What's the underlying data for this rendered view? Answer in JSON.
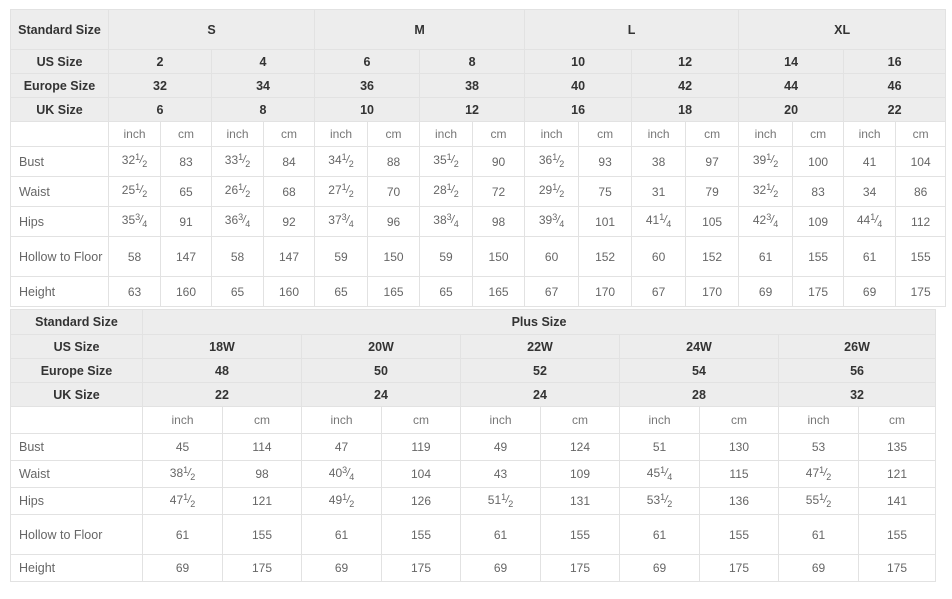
{
  "standard_table": {
    "label_column_header": "Standard Size",
    "row_labels": {
      "us": "US Size",
      "europe": "Europe Size",
      "uk": "UK Size",
      "bust": "Bust",
      "waist": "Waist",
      "hips": "Hips",
      "hollow": "Hollow to Floor",
      "height": "Height"
    },
    "unit_inch": "inch",
    "unit_cm": "cm",
    "groups": [
      {
        "name": "S",
        "span": 2
      },
      {
        "name": "M",
        "span": 2
      },
      {
        "name": "L",
        "span": 2
      },
      {
        "name": "XL",
        "span": 2
      }
    ],
    "us_sizes": [
      "2",
      "4",
      "6",
      "8",
      "10",
      "12",
      "14",
      "16"
    ],
    "europe_sizes": [
      "32",
      "34",
      "36",
      "38",
      "40",
      "42",
      "44",
      "46"
    ],
    "uk_sizes": [
      "6",
      "8",
      "10",
      "12",
      "16",
      "18",
      "20",
      "22"
    ],
    "measurements": [
      {
        "label": "Bust",
        "inch": [
          "32 1/2",
          "33 1/2",
          "34 1/2",
          "35 1/2",
          "36 1/2",
          "38",
          "39 1/2",
          "41"
        ],
        "cm": [
          "83",
          "84",
          "88",
          "90",
          "93",
          "97",
          "100",
          "104"
        ]
      },
      {
        "label": "Waist",
        "inch": [
          "25 1/2",
          "26 1/2",
          "27 1/2",
          "28 1/2",
          "29 1/2",
          "31",
          "32 1/2",
          "34"
        ],
        "cm": [
          "65",
          "68",
          "70",
          "72",
          "75",
          "79",
          "83",
          "86"
        ]
      },
      {
        "label": "Hips",
        "inch": [
          "35 3/4",
          "36 3/4",
          "37 3/4",
          "38 3/4",
          "39 3/4",
          "41 1/4",
          "42 3/4",
          "44 1/4"
        ],
        "cm": [
          "91",
          "92",
          "96",
          "98",
          "101",
          "105",
          "109",
          "112"
        ]
      },
      {
        "label": "Hollow to Floor",
        "inch": [
          "58",
          "58",
          "59",
          "59",
          "60",
          "60",
          "61",
          "61"
        ],
        "cm": [
          "147",
          "147",
          "150",
          "150",
          "152",
          "152",
          "155",
          "155"
        ]
      },
      {
        "label": "Height",
        "inch": [
          "63",
          "65",
          "65",
          "65",
          "67",
          "67",
          "69",
          "69"
        ],
        "cm": [
          "160",
          "160",
          "165",
          "165",
          "170",
          "170",
          "175",
          "175"
        ]
      }
    ]
  },
  "plus_table": {
    "label_column_header": "Standard Size",
    "group_title": "Plus Size",
    "row_labels": {
      "us": "US Size",
      "europe": "Europe Size",
      "uk": "UK Size"
    },
    "unit_inch": "inch",
    "unit_cm": "cm",
    "us_sizes": [
      "18W",
      "20W",
      "22W",
      "24W",
      "26W"
    ],
    "europe_sizes": [
      "48",
      "50",
      "52",
      "54",
      "56"
    ],
    "uk_sizes": [
      "22",
      "24",
      "24",
      "28",
      "32"
    ],
    "measurements": [
      {
        "label": "Bust",
        "inch": [
          "45",
          "47",
          "49",
          "51",
          "53"
        ],
        "cm": [
          "114",
          "119",
          "124",
          "130",
          "135"
        ]
      },
      {
        "label": "Waist",
        "inch": [
          "38 1/2",
          "40 3/4",
          "43",
          "45 1/4",
          "47 1/2"
        ],
        "cm": [
          "98",
          "104",
          "109",
          "115",
          "121"
        ]
      },
      {
        "label": "Hips",
        "inch": [
          "47 1/2",
          "49 1/2",
          "51 1/2",
          "53 1/2",
          "55 1/2"
        ],
        "cm": [
          "121",
          "126",
          "131",
          "136",
          "141"
        ]
      },
      {
        "label": "Hollow to Floor",
        "inch": [
          "61",
          "61",
          "61",
          "61",
          "61"
        ],
        "cm": [
          "155",
          "155",
          "155",
          "155",
          "155"
        ]
      },
      {
        "label": "Height",
        "inch": [
          "69",
          "69",
          "69",
          "69",
          "69"
        ],
        "cm": [
          "175",
          "175",
          "175",
          "175",
          "175"
        ]
      }
    ]
  },
  "colors": {
    "header_bg": "#ededed",
    "body_bg": "#ffffff",
    "border": "#e2e2e2",
    "header_text": "#333333",
    "body_text": "#666666"
  }
}
